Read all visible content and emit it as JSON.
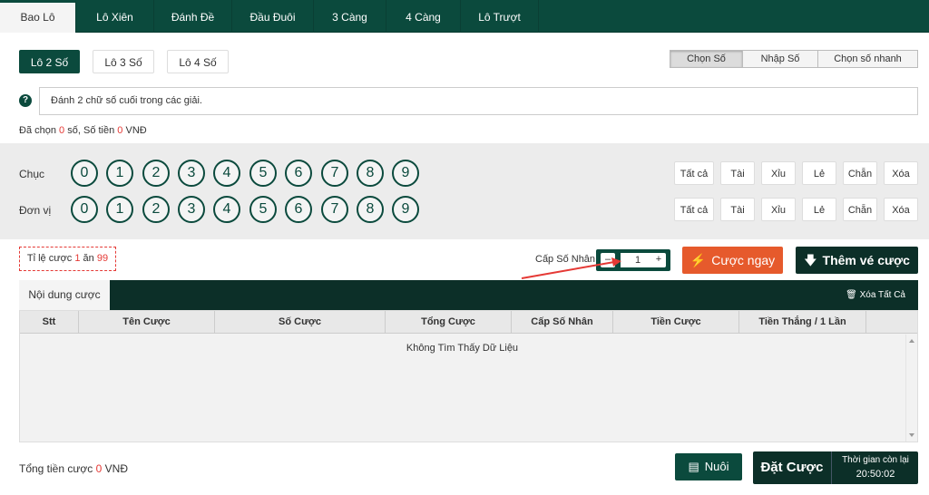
{
  "top_tabs": [
    "Bao Lô",
    "Lô Xiên",
    "Đánh Đề",
    "Đầu Đuôi",
    "3 Càng",
    "4 Càng",
    "Lô Trượt"
  ],
  "lo_types": [
    "Lô 2 Số",
    "Lô 3 Số",
    "Lô 4 Số"
  ],
  "modes": [
    "Chọn Số",
    "Nhập Số",
    "Chọn số nhanh"
  ],
  "info_text": "Đánh 2 chữ số cuối trong các giải.",
  "selection": {
    "prefix": "Đã chọn",
    "count": "0",
    "count_unit": "số,",
    "amount_label": "Số tiền",
    "amount": "0",
    "currency": "VNĐ"
  },
  "rows": [
    {
      "label": "Chục"
    },
    {
      "label": "Đơn vị"
    }
  ],
  "digits": [
    "0",
    "1",
    "2",
    "3",
    "4",
    "5",
    "6",
    "7",
    "8",
    "9"
  ],
  "quick_buttons": [
    "Tất cả",
    "Tài",
    "Xỉu",
    "Lẻ",
    "Chẵn",
    "Xóa"
  ],
  "ratio": {
    "label": "Tỉ lệ cược",
    "left": "1",
    "mid": "ăn",
    "right": "99"
  },
  "multiplier": {
    "label": "Cấp Số Nhân",
    "minus": "–",
    "value": "1",
    "plus": "+"
  },
  "bet_now": "Cược ngay",
  "add_ticket": "Thêm vé cược",
  "table": {
    "tab": "Nội dung cược",
    "clear_all": "Xóa Tất Cả",
    "headers": [
      "Stt",
      "Tên Cược",
      "Số Cược",
      "Tổng Cược",
      "Cấp Số Nhân",
      "Tiền Cược",
      "Tiền Thắng / 1 Lần"
    ],
    "empty": "Không Tìm Thấy Dữ Liệu"
  },
  "footer": {
    "total_label": "Tổng tiền cược",
    "total_value": "0",
    "currency": "VNĐ",
    "nuoi": "Nuôi",
    "place_bet": "Đặt Cược",
    "time_label": "Thời gian còn lại",
    "time_value": "20:50:02"
  },
  "colors": {
    "primary": "#0b4a3d",
    "dark": "#0c2f28",
    "accent": "#e65a2c",
    "red": "#e53935"
  }
}
